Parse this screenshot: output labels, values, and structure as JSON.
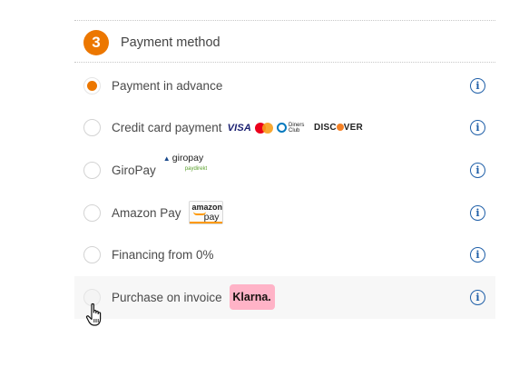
{
  "section": {
    "step_number": "3",
    "title": "Payment method"
  },
  "payment_options": [
    {
      "label": "Payment in advance",
      "selected": true,
      "info_icon": "i"
    },
    {
      "label": "Credit card payment",
      "selected": false,
      "info_icon": "i",
      "logos": {
        "visa": "VISA",
        "diners": "Diners Club",
        "discover": "DISC",
        "discover_end": "VER"
      }
    },
    {
      "label": "GiroPay",
      "selected": false,
      "info_icon": "i",
      "logos": {
        "giropay": "giropay",
        "paydirekt": "paydirekt"
      }
    },
    {
      "label": "Amazon Pay",
      "selected": false,
      "info_icon": "i",
      "logos": {
        "amazon": "amazon",
        "pay": "pay"
      }
    },
    {
      "label": "Financing from 0%",
      "selected": false,
      "info_icon": "i"
    },
    {
      "label": "Purchase on invoice",
      "selected": false,
      "hovered": true,
      "info_icon": "i",
      "logos": {
        "klarna": "Klarna."
      }
    }
  ],
  "colors": {
    "accent": "#ec7700",
    "info": "#1f5fa8",
    "klarna_pink": "#ffb3c7"
  },
  "icons": {
    "info": "info-circle-icon",
    "cursor": "hand-pointer-cursor"
  }
}
